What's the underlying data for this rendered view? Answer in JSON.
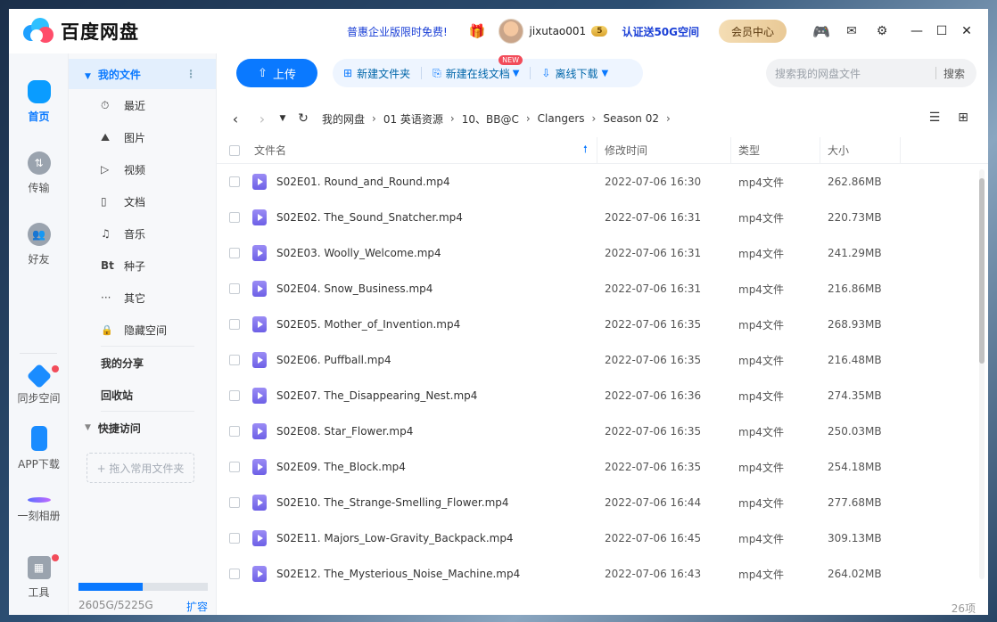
{
  "app": {
    "brand": "百度网盘",
    "promo": "普惠企业版限时免费!",
    "username": "jixutao001",
    "vip_badge": "5",
    "cert": "认证送50G空间",
    "vip_center": "会员中心"
  },
  "rail": [
    {
      "label": "首页",
      "icon": "cloud-icon",
      "active": true
    },
    {
      "label": "传输",
      "icon": "transfer-icon"
    },
    {
      "label": "好友",
      "icon": "friends-icon"
    },
    {
      "label": "同步空间",
      "icon": "sync-icon"
    },
    {
      "label": "APP下载",
      "icon": "phone-icon"
    },
    {
      "label": "一刻相册",
      "icon": "album-icon"
    },
    {
      "label": "工具",
      "icon": "tools-icon"
    }
  ],
  "nav": {
    "my_files": "我的文件",
    "items": [
      {
        "label": "最近",
        "icon": "⏱"
      },
      {
        "label": "图片",
        "icon": "⛰"
      },
      {
        "label": "视频",
        "icon": "▷"
      },
      {
        "label": "文档",
        "icon": "▯"
      },
      {
        "label": "音乐",
        "icon": "♫"
      },
      {
        "label": "种子",
        "icon": "Bt"
      },
      {
        "label": "其它",
        "icon": "···"
      },
      {
        "label": "隐藏空间",
        "icon": "🔒"
      }
    ],
    "my_share": "我的分享",
    "recycle": "回收站",
    "quick_access": "快捷访问",
    "drop_hint": "+ 拖入常用文件夹",
    "storage": "2605G/5225G",
    "storage_used_fraction": 0.499,
    "expand": "扩容"
  },
  "toolbar": {
    "upload": "上传",
    "new_folder": "新建文件夹",
    "new_doc": "新建在线文档",
    "new_badge": "NEW",
    "offline": "离线下载",
    "search_placeholder": "搜索我的网盘文件",
    "search_btn": "搜索"
  },
  "path": [
    "我的网盘",
    "01 英语资源",
    "10、BB@C",
    "Clangers",
    "Season 02"
  ],
  "columns": {
    "name": "文件名",
    "time": "修改时间",
    "type": "类型",
    "size": "大小"
  },
  "files": [
    {
      "name": "S02E01. Round_and_Round.mp4",
      "time": "2022-07-06 16:30",
      "type": "mp4文件",
      "size": "262.86MB"
    },
    {
      "name": "S02E02. The_Sound_Snatcher.mp4",
      "time": "2022-07-06 16:31",
      "type": "mp4文件",
      "size": "220.73MB"
    },
    {
      "name": "S02E03. Woolly_Welcome.mp4",
      "time": "2022-07-06 16:31",
      "type": "mp4文件",
      "size": "241.29MB"
    },
    {
      "name": "S02E04. Snow_Business.mp4",
      "time": "2022-07-06 16:31",
      "type": "mp4文件",
      "size": "216.86MB"
    },
    {
      "name": "S02E05. Mother_of_Invention.mp4",
      "time": "2022-07-06 16:35",
      "type": "mp4文件",
      "size": "268.93MB"
    },
    {
      "name": "S02E06. Puffball.mp4",
      "time": "2022-07-06 16:35",
      "type": "mp4文件",
      "size": "216.48MB"
    },
    {
      "name": "S02E07. The_Disappearing_Nest.mp4",
      "time": "2022-07-06 16:36",
      "type": "mp4文件",
      "size": "274.35MB"
    },
    {
      "name": "S02E08. Star_Flower.mp4",
      "time": "2022-07-06 16:35",
      "type": "mp4文件",
      "size": "250.03MB"
    },
    {
      "name": "S02E09. The_Block.mp4",
      "time": "2022-07-06 16:35",
      "type": "mp4文件",
      "size": "254.18MB"
    },
    {
      "name": "S02E10. The_Strange-Smelling_Flower.mp4",
      "time": "2022-07-06 16:44",
      "type": "mp4文件",
      "size": "277.68MB"
    },
    {
      "name": "S02E11. Majors_Low-Gravity_Backpack.mp4",
      "time": "2022-07-06 16:45",
      "type": "mp4文件",
      "size": "309.13MB"
    },
    {
      "name": "S02E12. The_Mysterious_Noise_Machine.mp4",
      "time": "2022-07-06 16:43",
      "type": "mp4文件",
      "size": "264.02MB"
    }
  ],
  "item_count": "26项"
}
